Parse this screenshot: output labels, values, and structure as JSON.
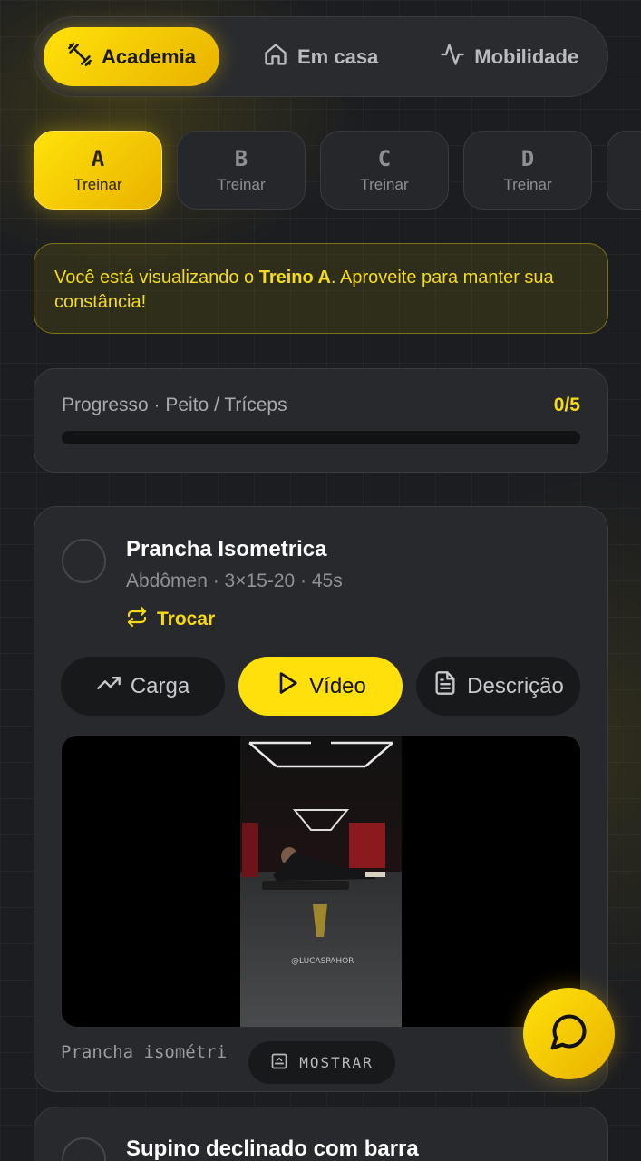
{
  "modes": {
    "academia": "Academia",
    "em_casa": "Em casa",
    "mobilidade": "Mobilidade"
  },
  "workouts": [
    {
      "letter": "A",
      "label": "Treinar",
      "active": true
    },
    {
      "letter": "B",
      "label": "Treinar"
    },
    {
      "letter": "C",
      "label": "Treinar"
    },
    {
      "letter": "D",
      "label": "Treinar"
    }
  ],
  "banner": {
    "prefix": "Você está visualizando o ",
    "highlight": "Treino A",
    "suffix": ". Aproveite para manter sua constância!"
  },
  "progress": {
    "label": "Progresso · Peito / Tríceps",
    "count": "0/5",
    "fraction": 0
  },
  "exercise": {
    "title": "Prancha Isometrica",
    "meta": "Abdômen · 3×15-20 · 45s",
    "swap_label": "Trocar",
    "actions": {
      "carga": "Carga",
      "video": "Vídeo",
      "descricao": "Descrição"
    },
    "video_watermark": "@LUCASPAHOR",
    "caption": "Prancha isométri",
    "show_label": "MOSTRAR"
  },
  "next_exercise": {
    "title": "Supino declinado com barra"
  },
  "colors": {
    "accent": "#f7d916",
    "background": "#1c1d20",
    "card": "#28292c"
  }
}
